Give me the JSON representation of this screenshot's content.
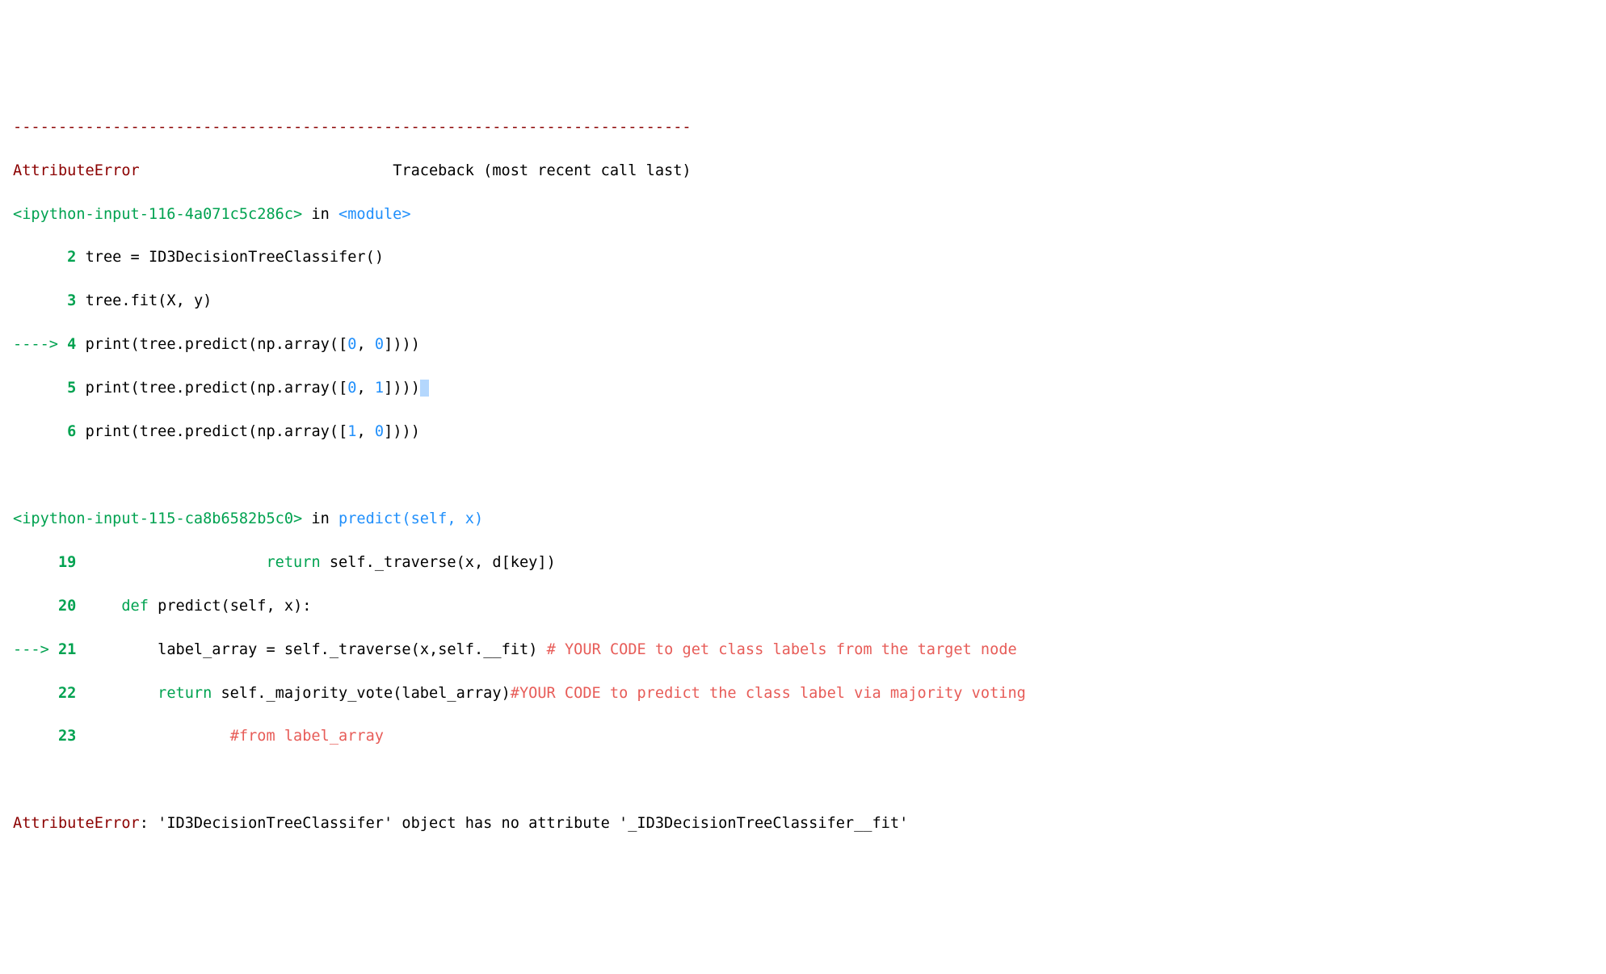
{
  "dash_line": "---------------------------------------------------------------------------",
  "err_name": "AttributeError",
  "err_spacing": "                            ",
  "tb_label": "Traceback (most recent call last)",
  "frame1": {
    "file": "<ipython-input-116-4a071c5c286c>",
    "in_word": " in ",
    "func": "<module>",
    "l2": {
      "gutter": "      ",
      "num": "2",
      "code_a": " tree ",
      "code_b": "=",
      "code_c": " ID3DecisionTreeClassifer",
      "code_d": "(",
      "code_e": ")"
    },
    "l3": {
      "gutter": "      ",
      "num": "3",
      "code_a": " tree",
      "code_b": ".",
      "code_c": "fit",
      "code_d": "(",
      "code_e": "X",
      "code_f": ",",
      "code_g": " y",
      "code_h": ")"
    },
    "l4": {
      "arrow": "----> ",
      "num": "4",
      "a": " print",
      "b": "(",
      "c": "tree",
      "d": ".",
      "e": "predict",
      "f": "(",
      "g": "np",
      "h": ".",
      "i": "array",
      "j": "(",
      "k": "[",
      "l": "0",
      "m": ",",
      "n": " ",
      "o": "0",
      "p": "]",
      "q": ")",
      "r": ")",
      "s": ")"
    },
    "l5": {
      "gutter": "      ",
      "num": "5",
      "a": " print",
      "b": "(",
      "c": "tree",
      "d": ".",
      "e": "predict",
      "f": "(",
      "g": "np",
      "h": ".",
      "i": "array",
      "j": "(",
      "k": "[",
      "l": "0",
      "m": ",",
      "n": " ",
      "o": "1",
      "p": "]",
      "q": ")",
      "r": ")",
      "s": ")",
      "cursor": " "
    },
    "l6": {
      "gutter": "      ",
      "num": "6",
      "a": " print",
      "b": "(",
      "c": "tree",
      "d": ".",
      "e": "predict",
      "f": "(",
      "g": "np",
      "h": ".",
      "i": "array",
      "j": "(",
      "k": "[",
      "l": "1",
      "m": ",",
      "n": " ",
      "o": "0",
      "p": "]",
      "q": ")",
      "r": ")",
      "s": ")"
    }
  },
  "frame2": {
    "file": "<ipython-input-115-ca8b6582b5c0>",
    "in_word": " in ",
    "func": "predict",
    "sig_a": "(",
    "sig_b": "self",
    "sig_c": ", ",
    "sig_d": "x",
    "sig_e": ")",
    "l19": {
      "gutter": "     ",
      "num": "19",
      "a": "                     ",
      "b": "return",
      "c": " self",
      "d": ".",
      "e": "_traverse",
      "f": "(",
      "g": "x",
      "h": ",",
      "i": " d",
      "j": "[",
      "k": "key",
      "l": "]",
      "m": ")"
    },
    "l20": {
      "gutter": "     ",
      "num": "20",
      "a": "     ",
      "b": "def",
      "c": " predict",
      "d": "(",
      "e": "self",
      "f": ",",
      "g": " x",
      "h": ")",
      "i": ":"
    },
    "l21": {
      "arrow": "---> ",
      "num": "21",
      "a": "         label_array ",
      "b": "=",
      "c": " self",
      "d": ".",
      "e": "_traverse",
      "f": "(",
      "g": "x",
      "h": ",",
      "i": "self",
      "j": ".",
      "k": "__fit",
      "l": ")",
      "m": " ",
      "comment": "# YOUR CODE to get class labels from the target node"
    },
    "l22": {
      "gutter": "     ",
      "num": "22",
      "a": "         ",
      "b": "return",
      "c": " self",
      "d": ".",
      "e": "_majority_vote",
      "f": "(",
      "g": "label_array",
      "h": ")",
      "comment": "#YOUR CODE to predict the class label via majority voting"
    },
    "l23": {
      "gutter": "     ",
      "num": "23",
      "a": "                 ",
      "comment": "#from label_array"
    }
  },
  "final": {
    "err_name": "AttributeError",
    "colon": ": ",
    "msg": "'ID3DecisionTreeClassifer' object has no attribute '_ID3DecisionTreeClassifer__fit'"
  }
}
